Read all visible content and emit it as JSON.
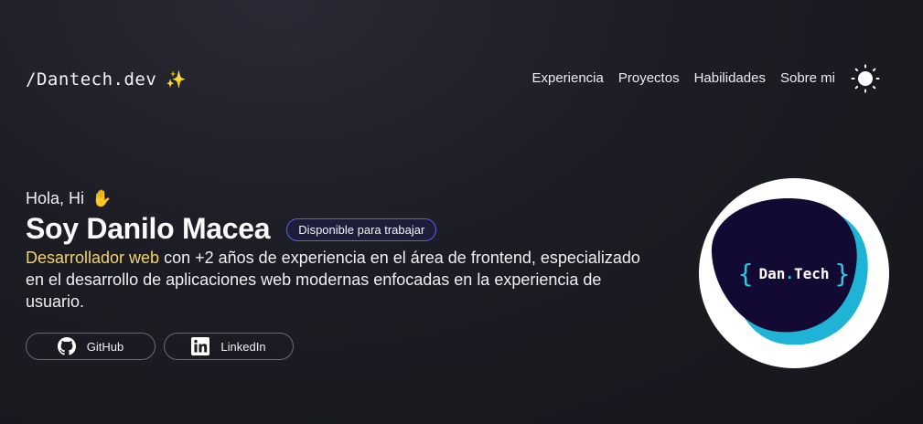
{
  "header": {
    "logo_text": "/Dantech.dev",
    "logo_emoji": "✨",
    "nav": [
      "Experiencia",
      "Proyectos",
      "Habilidades",
      "Sobre mi"
    ],
    "theme_icon": "sun-icon"
  },
  "hero": {
    "greeting": "Hola, Hi",
    "greeting_emoji": "✋",
    "name": "Soy Danilo Macea",
    "badge": "Disponible para trabajar",
    "role": "Desarrollador web",
    "description": " con +2 años de experiencia en el área de frontend, especializado en el desarrollo de aplicaciones web modernas enfocadas en la experiencia de usuario.",
    "social": [
      {
        "label": "GitHub",
        "icon": "github-icon"
      },
      {
        "label": "LinkedIn",
        "icon": "linkedin-icon"
      }
    ]
  },
  "avatar": {
    "brace_open": "{",
    "text_a": "Dan",
    "dot": ".",
    "text_b": "Tech",
    "brace_close": "}"
  },
  "colors": {
    "accent_yellow": "#f1d46a",
    "badge_border": "#5a5ee8",
    "avatar_blob": "#120a33",
    "avatar_shadow": "#1fb4d6"
  }
}
